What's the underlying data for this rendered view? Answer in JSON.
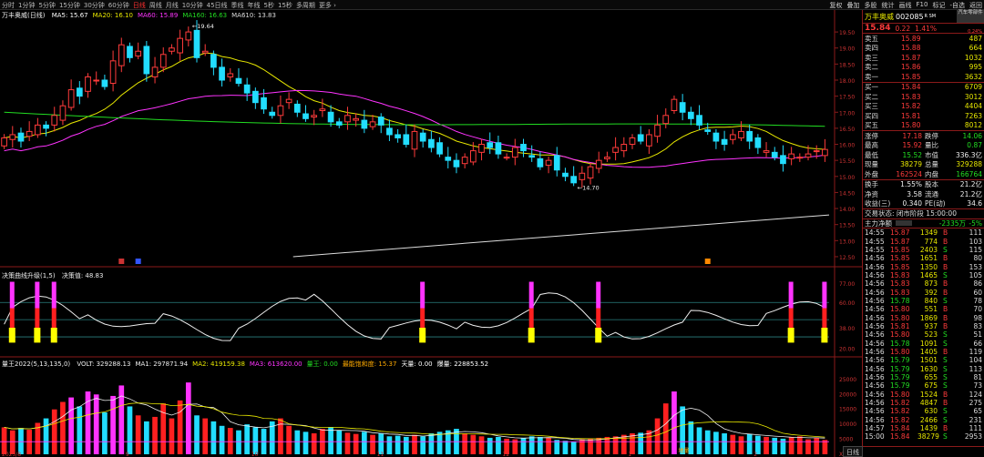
{
  "toolbar": {
    "periods": [
      "分时",
      "1分钟",
      "5分钟",
      "15分钟",
      "30分钟",
      "60分钟",
      "日线",
      "周线",
      "月线",
      "10分钟",
      "45日线",
      "季线",
      "年线",
      "5秒",
      "15秒",
      "多周期",
      "更多 ›"
    ],
    "active_period": "日线",
    "right_tools": [
      "复权",
      "叠加",
      "多股",
      "统计",
      "画线",
      "F10",
      "标记",
      "-自选",
      "返回"
    ]
  },
  "main_chart": {
    "title": "万丰奥威(日线)",
    "ma_labels": [
      {
        "text": "MA5: 15.67",
        "color": "#ffffff"
      },
      {
        "text": "MA20: 16.10",
        "color": "#e8e800"
      },
      {
        "text": "MA60: 15.89",
        "color": "#ff33ff"
      },
      {
        "text": "MA160: 16.63",
        "color": "#22dd22"
      },
      {
        "text": "MA610: 13.83",
        "color": "#dddddd"
      }
    ],
    "high_label": "19.64",
    "low_label": "14.70",
    "price_axis": [
      "19.50",
      "19.00",
      "18.50",
      "18.00",
      "17.50",
      "17.00",
      "16.50",
      "16.00",
      "15.50",
      "15.00",
      "14.50",
      "14.00",
      "13.50",
      "13.00",
      "12.50"
    ],
    "markers": [
      "",
      "融",
      "融"
    ]
  },
  "indicator1": {
    "title": "决策曲线升级(1,5)",
    "value_label": "决策值: 48.83",
    "axis": [
      "77.00",
      "60.00",
      "38.00",
      "20.00"
    ]
  },
  "indicator2": {
    "title": "量王2022(5,13,135,0)",
    "labels": [
      {
        "text": "VOLT: 329288.13",
        "color": "#eeeeee"
      },
      {
        "text": "MA1: 297871.94",
        "color": "#eeeeee"
      },
      {
        "text": "MA2: 419159.38",
        "color": "#e8e800"
      },
      {
        "text": "MA3: 613620.00",
        "color": "#ff33ff"
      },
      {
        "text": "量王: 0.00",
        "color": "#22dd22"
      },
      {
        "text": "最能饱和度: 15.37",
        "color": "#ffaa00"
      },
      {
        "text": "天量: 0.00",
        "color": "#ffffff"
      },
      {
        "text": "爆量: 228853.52",
        "color": "#ffffff"
      }
    ],
    "axis": [
      "25000",
      "20000",
      "15000",
      "10000",
      "5000",
      "X100"
    ],
    "dates": [
      "2025/8",
      "9",
      "10",
      "11",
      "12",
      "1",
      "2"
    ],
    "tag": "地量"
  },
  "quote": {
    "name": "万丰奥威",
    "code": "002085",
    "tag": "R SM",
    "sector": "汽车零部件",
    "price": "15.84",
    "change": "0.22",
    "pct": "1.41%",
    "sub_pct": "0.24%",
    "asks": [
      {
        "label": "卖五",
        "price": "15.89",
        "vol": "487"
      },
      {
        "label": "卖四",
        "price": "15.88",
        "vol": "664"
      },
      {
        "label": "卖三",
        "price": "15.87",
        "vol": "1032"
      },
      {
        "label": "卖二",
        "price": "15.86",
        "vol": "995"
      },
      {
        "label": "卖一",
        "price": "15.85",
        "vol": "3632"
      }
    ],
    "bids": [
      {
        "label": "买一",
        "price": "15.84",
        "vol": "6709"
      },
      {
        "label": "买二",
        "price": "15.83",
        "vol": "3012"
      },
      {
        "label": "买三",
        "price": "15.82",
        "vol": "4404"
      },
      {
        "label": "买四",
        "price": "15.81",
        "vol": "7263"
      },
      {
        "label": "买五",
        "price": "15.80",
        "vol": "8012"
      }
    ],
    "stats": [
      {
        "l1": "涨停",
        "v1": "17.18",
        "c1": "red",
        "l2": "跌停",
        "v2": "14.06",
        "c2": "grn"
      },
      {
        "l1": "最高",
        "v1": "15.92",
        "c1": "red",
        "l2": "量比",
        "v2": "0.87",
        "c2": "grn"
      },
      {
        "l1": "最低",
        "v1": "15.52",
        "c1": "grn",
        "l2": "市值",
        "v2": "336.3亿",
        "c2": "wht"
      },
      {
        "l1": "现量",
        "v1": "38279",
        "c1": "yel",
        "l2": "总量",
        "v2": "329288",
        "c2": "yel"
      },
      {
        "l1": "外盘",
        "v1": "162524",
        "c1": "red",
        "l2": "内盘",
        "v2": "166764",
        "c2": "grn"
      }
    ],
    "stats2": [
      {
        "l1": "换手",
        "v1": "1.55%",
        "c1": "wht",
        "l2": "股本",
        "v2": "21.2亿",
        "c2": "wht"
      },
      {
        "l1": "净资",
        "v1": "3.58",
        "c1": "wht",
        "l2": "流通",
        "v2": "21.2亿",
        "c2": "wht"
      },
      {
        "l1": "收益(三)",
        "v1": "0.340",
        "c1": "wht",
        "l2": "PE(动)",
        "v2": "34.6",
        "c2": "wht"
      }
    ],
    "status": "交易状态: 闭市阶段 15:00:00",
    "flow_label": "主力净额",
    "flow_value": "-2335万",
    "flow_pct": "-5%",
    "ticks": [
      {
        "t": "14:55",
        "p": "15.87",
        "c": "red",
        "v": "1349",
        "b": "B",
        "bc": "red",
        "n": "111"
      },
      {
        "t": "14:55",
        "p": "15.87",
        "c": "red",
        "v": "774",
        "b": "B",
        "bc": "red",
        "n": "103"
      },
      {
        "t": "14:55",
        "p": "15.85",
        "c": "red",
        "v": "2403",
        "b": "S",
        "bc": "grn",
        "n": "115"
      },
      {
        "t": "14:56",
        "p": "15.85",
        "c": "red",
        "v": "1651",
        "b": "B",
        "bc": "red",
        "n": "80"
      },
      {
        "t": "14:56",
        "p": "15.85",
        "c": "red",
        "v": "1350",
        "b": "B",
        "bc": "red",
        "n": "153"
      },
      {
        "t": "14:56",
        "p": "15.83",
        "c": "red",
        "v": "1465",
        "b": "S",
        "bc": "grn",
        "n": "105"
      },
      {
        "t": "14:56",
        "p": "15.83",
        "c": "red",
        "v": "873",
        "b": "B",
        "bc": "red",
        "n": "86"
      },
      {
        "t": "14:56",
        "p": "15.83",
        "c": "red",
        "v": "392",
        "b": "B",
        "bc": "red",
        "n": "60"
      },
      {
        "t": "14:56",
        "p": "15.78",
        "c": "grn",
        "v": "840",
        "b": "S",
        "bc": "grn",
        "n": "78"
      },
      {
        "t": "14:56",
        "p": "15.80",
        "c": "red",
        "v": "551",
        "b": "B",
        "bc": "red",
        "n": "70"
      },
      {
        "t": "14:56",
        "p": "15.80",
        "c": "red",
        "v": "1869",
        "b": "B",
        "bc": "red",
        "n": "98"
      },
      {
        "t": "14:56",
        "p": "15.81",
        "c": "red",
        "v": "937",
        "b": "B",
        "bc": "red",
        "n": "83"
      },
      {
        "t": "14:56",
        "p": "15.80",
        "c": "red",
        "v": "523",
        "b": "S",
        "bc": "grn",
        "n": "51"
      },
      {
        "t": "14:56",
        "p": "15.78",
        "c": "grn",
        "v": "1091",
        "b": "S",
        "bc": "grn",
        "n": "66"
      },
      {
        "t": "14:56",
        "p": "15.80",
        "c": "red",
        "v": "1405",
        "b": "B",
        "bc": "red",
        "n": "119"
      },
      {
        "t": "14:56",
        "p": "15.79",
        "c": "grn",
        "v": "1501",
        "b": "S",
        "bc": "grn",
        "n": "104"
      },
      {
        "t": "14:56",
        "p": "15.79",
        "c": "grn",
        "v": "1630",
        "b": "S",
        "bc": "grn",
        "n": "113"
      },
      {
        "t": "14:56",
        "p": "15.79",
        "c": "grn",
        "v": "655",
        "b": "S",
        "bc": "grn",
        "n": "81"
      },
      {
        "t": "14:56",
        "p": "15.79",
        "c": "grn",
        "v": "675",
        "b": "S",
        "bc": "grn",
        "n": "73"
      },
      {
        "t": "14:56",
        "p": "15.80",
        "c": "red",
        "v": "1524",
        "b": "B",
        "bc": "red",
        "n": "124"
      },
      {
        "t": "14:56",
        "p": "15.82",
        "c": "red",
        "v": "4847",
        "b": "B",
        "bc": "red",
        "n": "275"
      },
      {
        "t": "14:56",
        "p": "15.82",
        "c": "red",
        "v": "630",
        "b": "S",
        "bc": "grn",
        "n": "65"
      },
      {
        "t": "14:56",
        "p": "15.82",
        "c": "red",
        "v": "2466",
        "b": "S",
        "bc": "grn",
        "n": "231"
      },
      {
        "t": "14:57",
        "p": "15.84",
        "c": "red",
        "v": "1439",
        "b": "B",
        "bc": "red",
        "n": "111"
      },
      {
        "t": "15:00",
        "p": "15.84",
        "c": "red",
        "v": "38279",
        "b": "S",
        "bc": "grn",
        "n": "2953"
      }
    ],
    "bottom_tab": "日线"
  },
  "chart_data": {
    "type": "candlestick",
    "ylim": [
      12.3,
      19.9
    ],
    "close": [
      16.2,
      16.3,
      16.1,
      16.4,
      16.6,
      16.5,
      16.9,
      17.2,
      17.7,
      17.5,
      18.1,
      18.0,
      17.8,
      18.6,
      19.1,
      18.7,
      18.9,
      18.2,
      18.4,
      18.8,
      19.0,
      19.3,
      19.5,
      18.7,
      18.9,
      18.4,
      18.0,
      18.2,
      17.9,
      17.6,
      17.3,
      17.1,
      16.9,
      17.2,
      17.4,
      17.0,
      16.8,
      16.9,
      17.1,
      16.7,
      16.6,
      16.9,
      16.8,
      16.5,
      16.7,
      16.6,
      16.3,
      16.2,
      16.0,
      16.4,
      16.1,
      15.9,
      15.7,
      15.5,
      15.3,
      15.6,
      15.8,
      16.0,
      15.9,
      15.7,
      15.6,
      15.9,
      15.8,
      15.6,
      15.3,
      15.5,
      15.2,
      15.0,
      14.8,
      15.1,
      15.3,
      15.5,
      15.6,
      15.9,
      16.0,
      16.2,
      16.1,
      16.3,
      16.6,
      16.9,
      17.4,
      17.0,
      16.8,
      16.6,
      16.4,
      16.1,
      16.0,
      16.3,
      16.4,
      16.1,
      15.9,
      15.8,
      15.6,
      15.4,
      15.7,
      15.6,
      15.7,
      15.8,
      15.84
    ],
    "volume_x100": [
      9000,
      8000,
      8800,
      8200,
      10500,
      12000,
      15000,
      17500,
      19000,
      16000,
      21000,
      20000,
      14000,
      19500,
      23000,
      16000,
      13000,
      11000,
      12500,
      17000,
      12000,
      18000,
      24000,
      13000,
      12000,
      11000,
      9500,
      8800,
      8000,
      10000,
      9000,
      8500,
      11000,
      12000,
      9500,
      8000,
      7500,
      7000,
      8500,
      9000,
      8000,
      7200,
      6800,
      7500,
      6500,
      7000,
      6000,
      6200,
      5800,
      6500,
      6000,
      7000,
      7500,
      8000,
      8500,
      7000,
      6500,
      6000,
      5500,
      5800,
      5200,
      5000,
      5500,
      6000,
      5800,
      5500,
      4800,
      4500,
      4200,
      5000,
      5200,
      5500,
      5800,
      6000,
      6500,
      7000,
      7200,
      8000,
      12000,
      17000,
      21000,
      16000,
      11000,
      9000,
      8000,
      7500,
      7000,
      6500,
      6000,
      6800,
      6200,
      5800,
      5500,
      5200,
      5800,
      6000,
      5000,
      5500,
      4800
    ],
    "ma_series": [
      {
        "name": "MA20",
        "color": "#e8e800"
      },
      {
        "name": "MA60",
        "color": "#ff33ff"
      },
      {
        "name": "MA160",
        "color": "#22dd22"
      },
      {
        "name": "MA610",
        "color": "#dddddd"
      }
    ]
  }
}
